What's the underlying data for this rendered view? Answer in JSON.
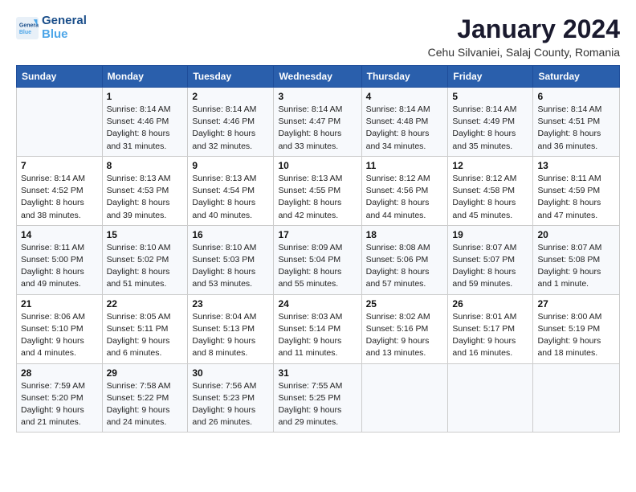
{
  "logo": {
    "line1": "General",
    "line2": "Blue"
  },
  "title": "January 2024",
  "subtitle": "Cehu Silvaniei, Salaj County, Romania",
  "days_of_week": [
    "Sunday",
    "Monday",
    "Tuesday",
    "Wednesday",
    "Thursday",
    "Friday",
    "Saturday"
  ],
  "weeks": [
    [
      {
        "num": "",
        "detail": ""
      },
      {
        "num": "1",
        "detail": "Sunrise: 8:14 AM\nSunset: 4:46 PM\nDaylight: 8 hours\nand 31 minutes."
      },
      {
        "num": "2",
        "detail": "Sunrise: 8:14 AM\nSunset: 4:46 PM\nDaylight: 8 hours\nand 32 minutes."
      },
      {
        "num": "3",
        "detail": "Sunrise: 8:14 AM\nSunset: 4:47 PM\nDaylight: 8 hours\nand 33 minutes."
      },
      {
        "num": "4",
        "detail": "Sunrise: 8:14 AM\nSunset: 4:48 PM\nDaylight: 8 hours\nand 34 minutes."
      },
      {
        "num": "5",
        "detail": "Sunrise: 8:14 AM\nSunset: 4:49 PM\nDaylight: 8 hours\nand 35 minutes."
      },
      {
        "num": "6",
        "detail": "Sunrise: 8:14 AM\nSunset: 4:51 PM\nDaylight: 8 hours\nand 36 minutes."
      }
    ],
    [
      {
        "num": "7",
        "detail": "Sunrise: 8:14 AM\nSunset: 4:52 PM\nDaylight: 8 hours\nand 38 minutes."
      },
      {
        "num": "8",
        "detail": "Sunrise: 8:13 AM\nSunset: 4:53 PM\nDaylight: 8 hours\nand 39 minutes."
      },
      {
        "num": "9",
        "detail": "Sunrise: 8:13 AM\nSunset: 4:54 PM\nDaylight: 8 hours\nand 40 minutes."
      },
      {
        "num": "10",
        "detail": "Sunrise: 8:13 AM\nSunset: 4:55 PM\nDaylight: 8 hours\nand 42 minutes."
      },
      {
        "num": "11",
        "detail": "Sunrise: 8:12 AM\nSunset: 4:56 PM\nDaylight: 8 hours\nand 44 minutes."
      },
      {
        "num": "12",
        "detail": "Sunrise: 8:12 AM\nSunset: 4:58 PM\nDaylight: 8 hours\nand 45 minutes."
      },
      {
        "num": "13",
        "detail": "Sunrise: 8:11 AM\nSunset: 4:59 PM\nDaylight: 8 hours\nand 47 minutes."
      }
    ],
    [
      {
        "num": "14",
        "detail": "Sunrise: 8:11 AM\nSunset: 5:00 PM\nDaylight: 8 hours\nand 49 minutes."
      },
      {
        "num": "15",
        "detail": "Sunrise: 8:10 AM\nSunset: 5:02 PM\nDaylight: 8 hours\nand 51 minutes."
      },
      {
        "num": "16",
        "detail": "Sunrise: 8:10 AM\nSunset: 5:03 PM\nDaylight: 8 hours\nand 53 minutes."
      },
      {
        "num": "17",
        "detail": "Sunrise: 8:09 AM\nSunset: 5:04 PM\nDaylight: 8 hours\nand 55 minutes."
      },
      {
        "num": "18",
        "detail": "Sunrise: 8:08 AM\nSunset: 5:06 PM\nDaylight: 8 hours\nand 57 minutes."
      },
      {
        "num": "19",
        "detail": "Sunrise: 8:07 AM\nSunset: 5:07 PM\nDaylight: 8 hours\nand 59 minutes."
      },
      {
        "num": "20",
        "detail": "Sunrise: 8:07 AM\nSunset: 5:08 PM\nDaylight: 9 hours\nand 1 minute."
      }
    ],
    [
      {
        "num": "21",
        "detail": "Sunrise: 8:06 AM\nSunset: 5:10 PM\nDaylight: 9 hours\nand 4 minutes."
      },
      {
        "num": "22",
        "detail": "Sunrise: 8:05 AM\nSunset: 5:11 PM\nDaylight: 9 hours\nand 6 minutes."
      },
      {
        "num": "23",
        "detail": "Sunrise: 8:04 AM\nSunset: 5:13 PM\nDaylight: 9 hours\nand 8 minutes."
      },
      {
        "num": "24",
        "detail": "Sunrise: 8:03 AM\nSunset: 5:14 PM\nDaylight: 9 hours\nand 11 minutes."
      },
      {
        "num": "25",
        "detail": "Sunrise: 8:02 AM\nSunset: 5:16 PM\nDaylight: 9 hours\nand 13 minutes."
      },
      {
        "num": "26",
        "detail": "Sunrise: 8:01 AM\nSunset: 5:17 PM\nDaylight: 9 hours\nand 16 minutes."
      },
      {
        "num": "27",
        "detail": "Sunrise: 8:00 AM\nSunset: 5:19 PM\nDaylight: 9 hours\nand 18 minutes."
      }
    ],
    [
      {
        "num": "28",
        "detail": "Sunrise: 7:59 AM\nSunset: 5:20 PM\nDaylight: 9 hours\nand 21 minutes."
      },
      {
        "num": "29",
        "detail": "Sunrise: 7:58 AM\nSunset: 5:22 PM\nDaylight: 9 hours\nand 24 minutes."
      },
      {
        "num": "30",
        "detail": "Sunrise: 7:56 AM\nSunset: 5:23 PM\nDaylight: 9 hours\nand 26 minutes."
      },
      {
        "num": "31",
        "detail": "Sunrise: 7:55 AM\nSunset: 5:25 PM\nDaylight: 9 hours\nand 29 minutes."
      },
      {
        "num": "",
        "detail": ""
      },
      {
        "num": "",
        "detail": ""
      },
      {
        "num": "",
        "detail": ""
      }
    ]
  ]
}
